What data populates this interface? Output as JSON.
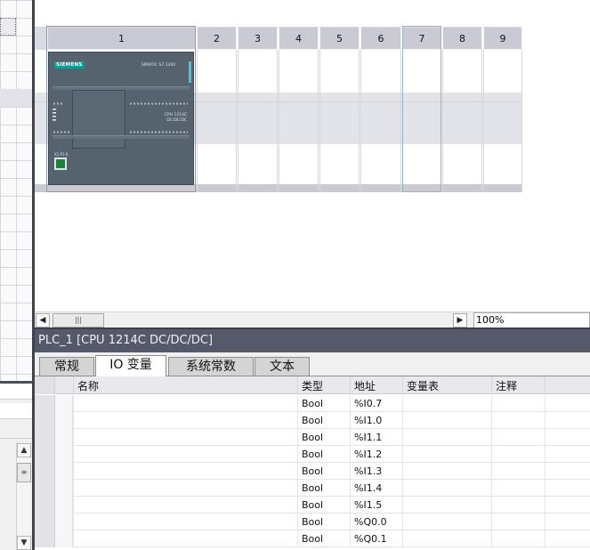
{
  "device_view": {
    "slots": [
      {
        "label": "1"
      },
      {
        "label": "2"
      },
      {
        "label": "3"
      },
      {
        "label": "4"
      },
      {
        "label": "5"
      },
      {
        "label": "6"
      },
      {
        "label": "7"
      },
      {
        "label": "8"
      },
      {
        "label": "9"
      }
    ],
    "plc": {
      "brand": "SIEMENS",
      "series": "SIMATIC S7-1200",
      "cpu_line1": "CPU 1214C",
      "cpu_line2": "DC/DC/DC",
      "port_label": "X1 P1 R"
    },
    "zoom": "100%"
  },
  "inspector": {
    "title": "PLC_1 [CPU 1214C DC/DC/DC]",
    "tabs": [
      {
        "label": "常规",
        "active": false
      },
      {
        "label": "IO 变量",
        "active": true
      },
      {
        "label": "系统常数",
        "active": false
      },
      {
        "label": "文本",
        "active": false
      }
    ],
    "table": {
      "columns": [
        "名称",
        "类型",
        "地址",
        "变量表",
        "注释"
      ],
      "rows": [
        {
          "name": "",
          "type": "Bool",
          "address": "%I0.7",
          "tag_table": "",
          "comment": ""
        },
        {
          "name": "",
          "type": "Bool",
          "address": "%I1.0",
          "tag_table": "",
          "comment": ""
        },
        {
          "name": "",
          "type": "Bool",
          "address": "%I1.1",
          "tag_table": "",
          "comment": ""
        },
        {
          "name": "",
          "type": "Bool",
          "address": "%I1.2",
          "tag_table": "",
          "comment": ""
        },
        {
          "name": "",
          "type": "Bool",
          "address": "%I1.3",
          "tag_table": "",
          "comment": ""
        },
        {
          "name": "",
          "type": "Bool",
          "address": "%I1.4",
          "tag_table": "",
          "comment": ""
        },
        {
          "name": "",
          "type": "Bool",
          "address": "%I1.5",
          "tag_table": "",
          "comment": ""
        },
        {
          "name": "",
          "type": "Bool",
          "address": "%Q0.0",
          "tag_table": "",
          "comment": ""
        },
        {
          "name": "",
          "type": "Bool",
          "address": "%Q0.1",
          "tag_table": "",
          "comment": ""
        }
      ]
    }
  },
  "icons": {
    "scroll_left": "◀",
    "scroll_right": "▶",
    "scroll_up": "▲",
    "scroll_down": "▼",
    "grip": "|||"
  },
  "colors": {
    "title_bar": "#55596a",
    "slot_header": "#c9cad3",
    "plc_body": "#56636f",
    "siemens_teal": "#0f9c94"
  }
}
